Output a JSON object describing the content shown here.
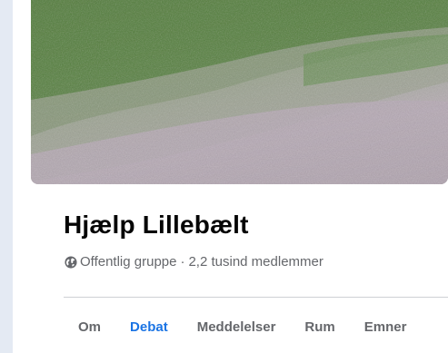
{
  "group": {
    "title": "Hjælp Lillebælt",
    "privacy": "Offentlig gruppe",
    "separator": "·",
    "members": "2,2 tusind medlemmer"
  },
  "icons": {
    "privacy": "globe-icon"
  },
  "tabs": [
    {
      "label": "Om",
      "active": false
    },
    {
      "label": "Debat",
      "active": true
    },
    {
      "label": "Meddelelser",
      "active": false
    },
    {
      "label": "Rum",
      "active": false
    },
    {
      "label": "Emner",
      "active": false
    }
  ],
  "colors": {
    "accent": "#1b74e4",
    "title": "#050505",
    "secondary_text": "#65676b",
    "divider": "#ced0d4"
  }
}
